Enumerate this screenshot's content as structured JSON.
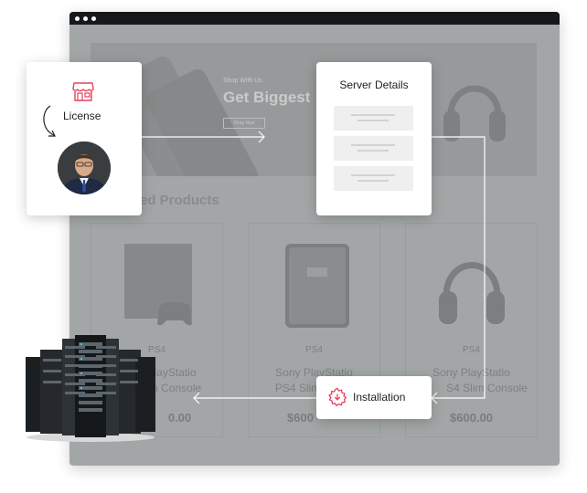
{
  "banner": {
    "small_text": "Shop With Us",
    "headline": "Get Biggest",
    "button_label": "Shop Now"
  },
  "section": {
    "title": "ed Products"
  },
  "products": [
    {
      "category": "PS4",
      "name_line1": "layStatio",
      "name_line2": "m Console",
      "price": "0.00"
    },
    {
      "category": "PS4",
      "name_line1": "Sony PlayStatio",
      "name_line2": "PS4 Slim",
      "price": "$600"
    },
    {
      "category": "PS4",
      "name_line1": "Sony PlayStatio",
      "name_line2": "S4 Slim Console",
      "price": "$600.00"
    }
  ],
  "flow": {
    "license_label": "License",
    "server_details_title": "Server Details",
    "installation_label": "Installation"
  },
  "colors": {
    "accent": "#e8425f",
    "browser_bar": "#15191b",
    "overlay_gray": "#a3a6a6"
  },
  "icons": {
    "license": "store-icon",
    "installation": "gear-icon",
    "window_dots": "window-dots-icon"
  }
}
